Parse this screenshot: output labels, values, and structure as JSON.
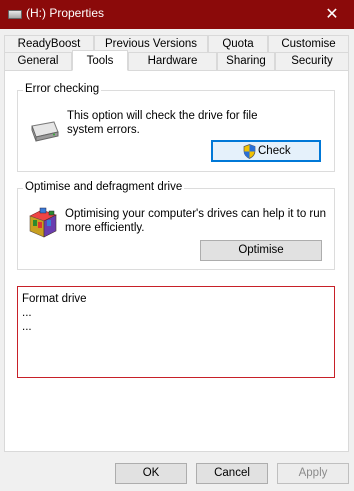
{
  "window": {
    "title": "(H:) Properties",
    "close_label": "✕"
  },
  "tabs": {
    "row1": [
      "ReadyBoost",
      "Previous Versions",
      "Quota",
      "Customise"
    ],
    "row2": [
      "General",
      "Tools",
      "Hardware",
      "Sharing",
      "Security"
    ],
    "active": "Tools"
  },
  "error_checking": {
    "legend": "Error checking",
    "description_line1": "This option will check the drive for file",
    "description_line2": "system errors.",
    "button": "Check"
  },
  "optimise": {
    "legend": "Optimise and defragment drive",
    "description_line1": "Optimising your computer's drives can help it to run",
    "description_line2": "more efficiently.",
    "button": "Optimise"
  },
  "format": {
    "title": "Format drive",
    "line1": "...",
    "line2": "..."
  },
  "footer": {
    "ok": "OK",
    "cancel": "Cancel",
    "apply": "Apply"
  },
  "colors": {
    "titlebar": "#8b0a0a",
    "focus_border": "#0078d7",
    "format_border": "#c72028"
  },
  "icons": {
    "titlebar": "drive-icon",
    "error_checking": "hard-drive-icon",
    "optimise": "defrag-icon",
    "check_button": "uac-shield-icon"
  }
}
